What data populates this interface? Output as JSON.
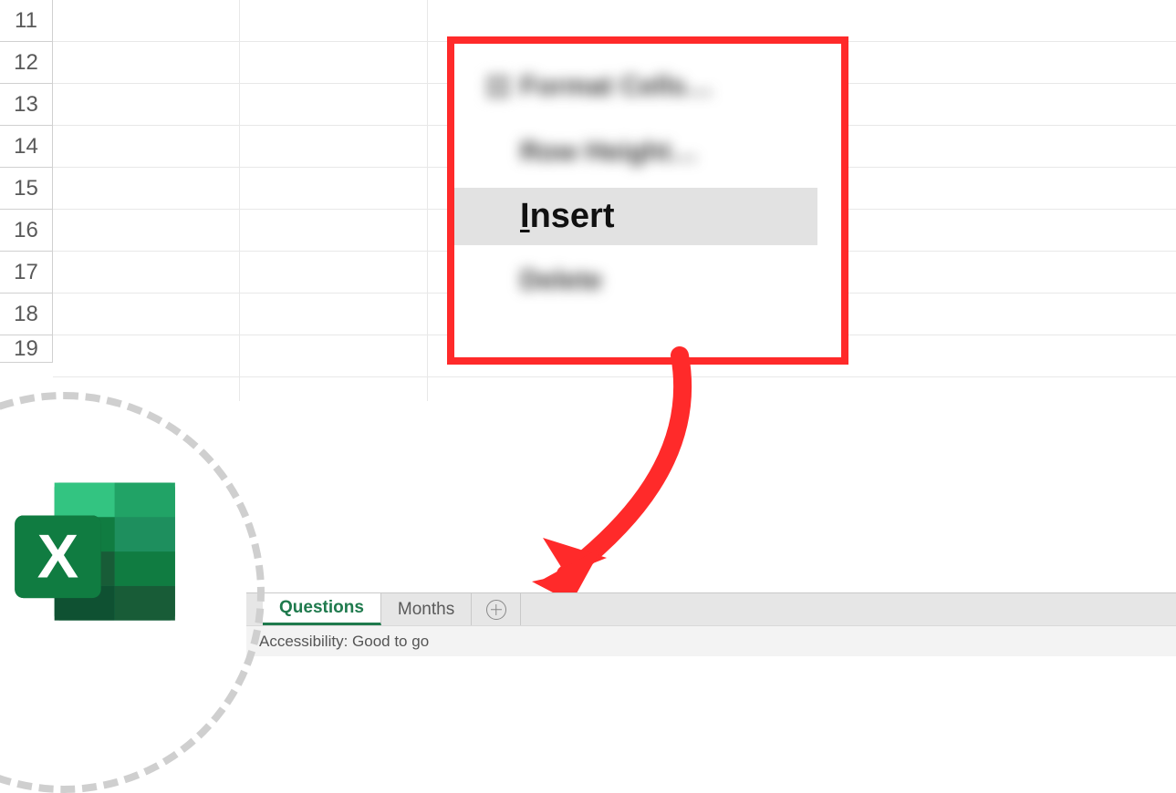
{
  "rows": [
    "11",
    "12",
    "13",
    "14",
    "15",
    "16",
    "17",
    "18",
    "19"
  ],
  "context_menu": {
    "item_format_cells": "Format Cells…",
    "item_row_height": "Row Height…",
    "item_insert_prefix": "I",
    "item_insert_rest": "nsert",
    "item_delete": "Delete"
  },
  "tabs": {
    "active": "Questions",
    "other": "Months"
  },
  "status": {
    "accessibility": "Accessibility: Good to go"
  },
  "logo_letter": "X"
}
